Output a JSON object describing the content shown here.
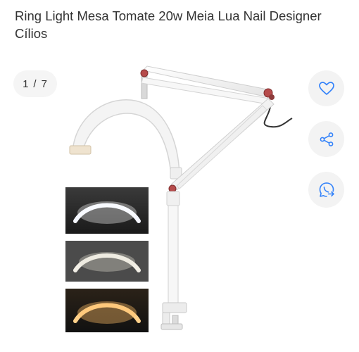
{
  "product": {
    "title": "Ring Light Mesa Tomate 20w Meia Lua Nail Designer Cílios"
  },
  "gallery": {
    "current": "1",
    "separator": "/",
    "total": "7"
  },
  "actions": [
    {
      "icon": "heart-icon"
    },
    {
      "icon": "share-icon"
    },
    {
      "icon": "whatsapp-icon"
    }
  ],
  "colors": {
    "accent": "#3483fa",
    "text": "#333333",
    "chip_bg": "#f5f5f5"
  }
}
